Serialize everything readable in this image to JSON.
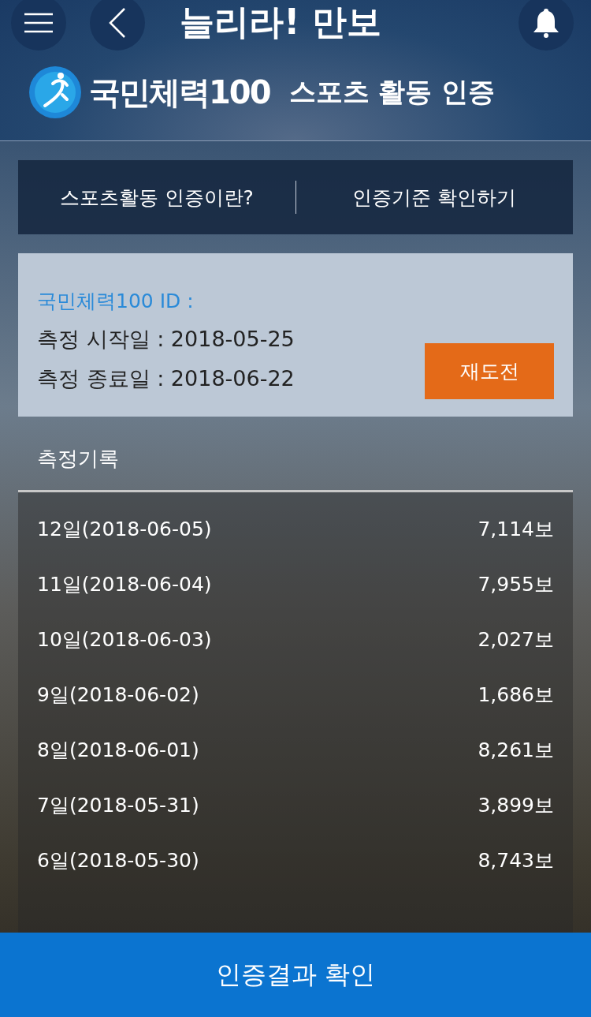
{
  "app_logo": {
    "text": "늘리라! 만보"
  },
  "header": {
    "brand": "국민체력100",
    "title": "스포츠 활동 인증"
  },
  "menu": [
    {
      "label": "스포츠활동 인증이란?"
    },
    {
      "label": "인증기준 확인하기"
    }
  ],
  "info": {
    "id_label": "국민체력100 ID :",
    "start": "측정 시작일 : 2018-05-25",
    "end": "측정 종료일 : 2018-06-22",
    "retry_button": "재도전"
  },
  "records_title": "측정기록",
  "records": [
    {
      "day": "12일(2018-06-05)",
      "steps": "7,114보"
    },
    {
      "day": "11일(2018-06-04)",
      "steps": "7,955보"
    },
    {
      "day": "10일(2018-06-03)",
      "steps": "2,027보"
    },
    {
      "day": "9일(2018-06-02)",
      "steps": "1,686보"
    },
    {
      "day": "8일(2018-06-01)",
      "steps": "8,261보"
    },
    {
      "day": "7일(2018-05-31)",
      "steps": "3,899보"
    },
    {
      "day": "6일(2018-05-30)",
      "steps": "8,743보"
    }
  ],
  "confirm_button": "인증결과 확인"
}
